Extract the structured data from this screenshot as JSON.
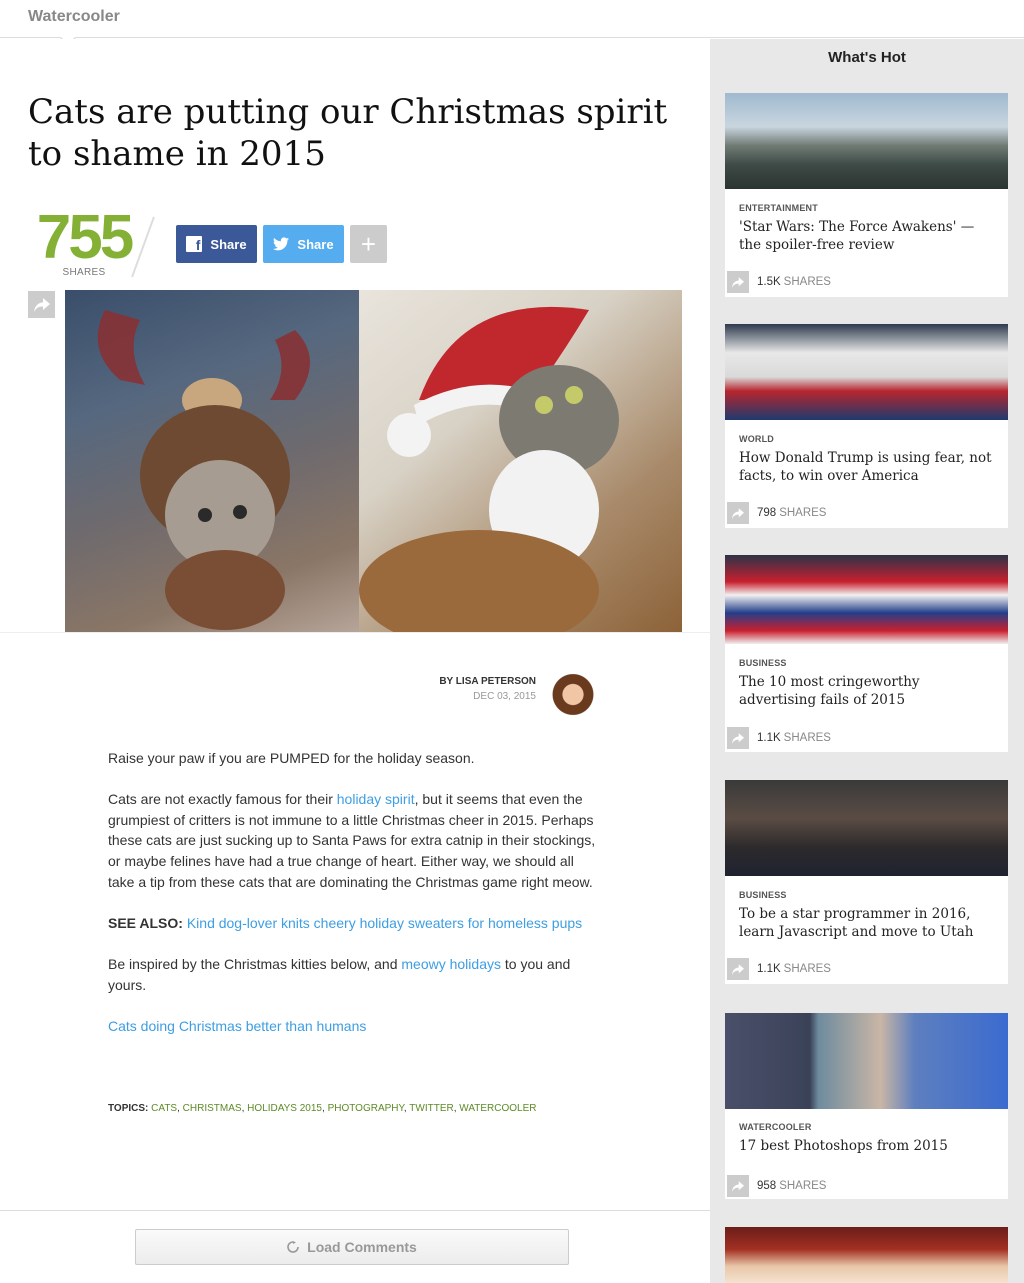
{
  "header": {
    "section": "Watercooler"
  },
  "article": {
    "headline": "Cats are putting our Christmas spirit to shame in 2015",
    "share_count": "755",
    "share_count_label": "SHARES",
    "facebook_label": "Share",
    "twitter_label": "Share",
    "more_label": "+",
    "byline": "BY LISA PETERSON",
    "date": "DEC 03, 2015",
    "p1": "Raise your paw if you are PUMPED for the holiday season.",
    "p2_a": "Cats are not exactly famous for their ",
    "p2_link": "holiday spirit",
    "p2_b": ", but it seems that even the grumpiest of critters is not immune to a little Christmas cheer in 2015. Perhaps these cats are just sucking up to Santa Paws for extra catnip in their stockings, or maybe felines have had a true change of heart. Either way, we should all take a tip from these cats that are dominating the Christmas game right meow.",
    "see_also_label": "SEE ALSO:",
    "see_also_link": "Kind dog-lover knits cheery holiday sweaters for homeless pups",
    "p4_a": "Be inspired by the Christmas kitties below, and ",
    "p4_link": "meowy holidays",
    "p4_b": " to you and yours.",
    "p5_link": "Cats doing Christmas better than humans",
    "topics_label": "TOPICS:",
    "topics": [
      "CATS",
      "CHRISTMAS",
      "HOLIDAYS 2015",
      "PHOTOGRAPHY",
      "TWITTER",
      "WATERCOOLER"
    ],
    "load_comments": "Load Comments"
  },
  "sidebar": {
    "title": "What's Hot",
    "shares_label": "SHARES",
    "cards": [
      {
        "category": "ENTERTAINMENT",
        "title": "'Star Wars: The Force Awakens' — the spoiler-free review",
        "shares": "1.5K"
      },
      {
        "category": "WORLD",
        "title": "How Donald Trump is using fear, not facts, to win over America",
        "shares": "798"
      },
      {
        "category": "BUSINESS",
        "title": "The 10 most cringeworthy advertising fails of 2015",
        "shares": "1.1K"
      },
      {
        "category": "BUSINESS",
        "title": "To be a star programmer in 2016, learn Javascript and move to Utah",
        "shares": "1.1K"
      },
      {
        "category": "WATERCOOLER",
        "title": "17 best Photoshops from 2015",
        "shares": "958"
      }
    ]
  },
  "colors": {
    "share_count_green": "#84b135",
    "facebook_blue": "#3b5998",
    "twitter_blue": "#55acee",
    "link_blue": "#3d9ee3",
    "topic_green": "#5d8a27"
  }
}
